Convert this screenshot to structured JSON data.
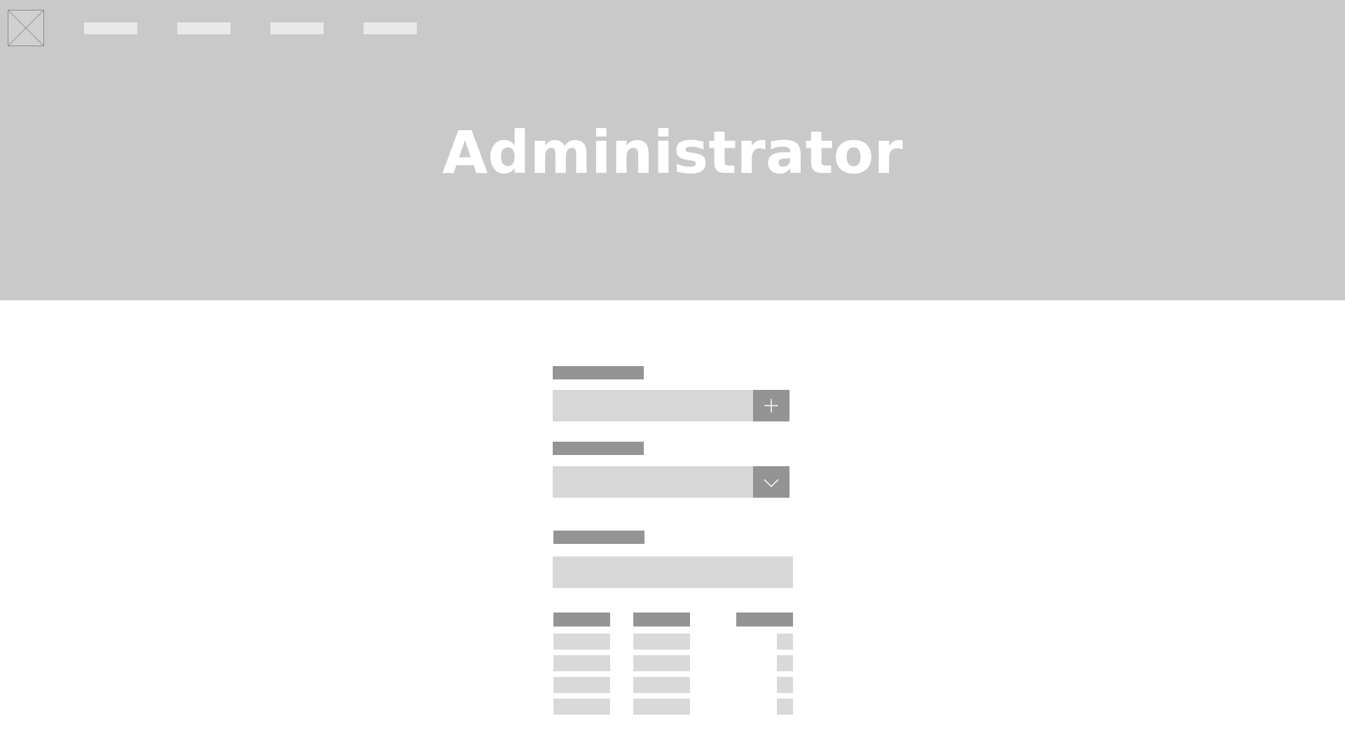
{
  "header": {
    "title": "Administrator",
    "logo_icon": "image-placeholder-icon",
    "nav_items": [
      "",
      "",
      "",
      ""
    ]
  },
  "form": {
    "fields": [
      {
        "label": "",
        "value": "",
        "action_icon": "plus-icon"
      },
      {
        "label": "",
        "value": "",
        "action_icon": "chevron-down-icon"
      },
      {
        "label": "",
        "value": ""
      }
    ]
  },
  "table": {
    "columns": [
      "",
      "",
      ""
    ],
    "rows": [
      [
        "",
        "",
        ""
      ],
      [
        "",
        "",
        ""
      ],
      [
        "",
        "",
        ""
      ],
      [
        "",
        "",
        ""
      ]
    ]
  },
  "colors": {
    "hero_bg": "#c9c9c9",
    "label_placeholder": "#949494",
    "field_placeholder": "#d7d7d7",
    "nav_placeholder": "#e9e9e9"
  }
}
